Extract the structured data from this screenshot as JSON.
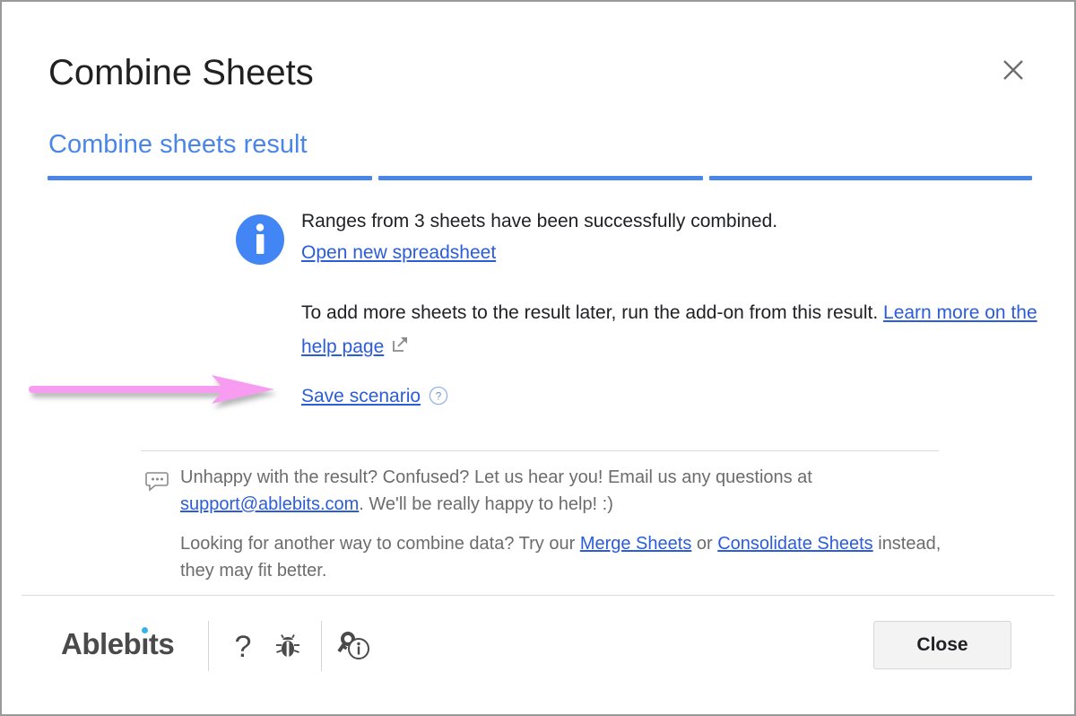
{
  "window": {
    "title": "Combine Sheets",
    "close_icon": "close-x-icon"
  },
  "step": {
    "title": "Combine sheets result",
    "progress_segments": 3,
    "progress_completed": 3,
    "accent_color": "#4a86e8"
  },
  "result": {
    "info_icon": "info-circle-icon",
    "message": "Ranges from 3 sheets have been successfully combined.",
    "open_link": "Open new spreadsheet",
    "paragraph_prefix": "To add more sheets to the result later, run the add-on from this result. ",
    "help_page_link": "Learn more on the help page",
    "external_link_icon": "external-link-icon",
    "save_scenario_link": "Save scenario",
    "save_scenario_help_icon": "question-mark-circle-icon"
  },
  "annotation": {
    "arrow_icon": "pink-arrow-icon",
    "arrow_color": "#f79cf0"
  },
  "support": {
    "icon": "speech-bubble-icon",
    "line1_part1": "Unhappy with the result? Confused? Let us hear you! Email us any questions at ",
    "email": "support@ablebits.com",
    "line1_part2": ". We'll be really happy to help! :)",
    "line2_part1": "Looking for another way to combine data? Try our ",
    "merge_sheets_link": "Merge Sheets",
    "line2_or": " or ",
    "consolidate_sheets_link": "Consolidate Sheets",
    "line2_part2": " instead, they may fit better."
  },
  "footer": {
    "brand_before": "Ablebits",
    "brand_name": "Ablebits",
    "help_icon": "question-mark-icon",
    "bug_icon": "bug-report-icon",
    "privacy_icon": "key-info-privacy-icon",
    "close_label": "Close",
    "brand_color": "#4a4a4a",
    "brand_dot_color": "#35b3ee"
  }
}
